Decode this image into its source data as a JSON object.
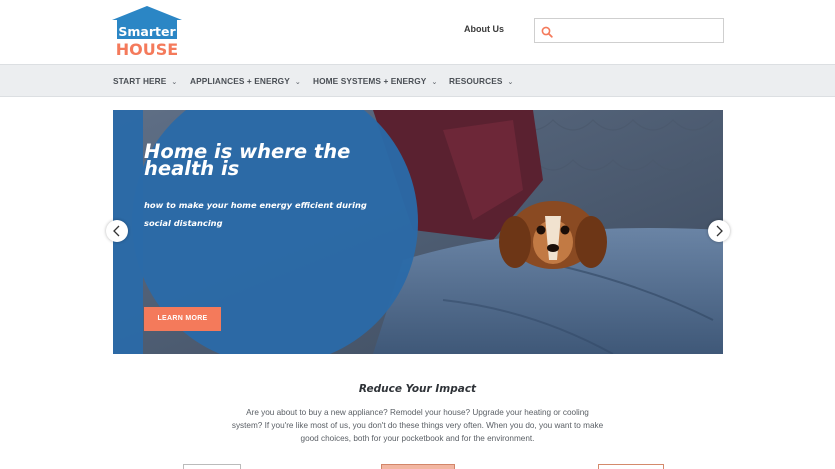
{
  "header": {
    "logo": {
      "line1": "Smarter",
      "line2": "HOUSE",
      "colors": {
        "roof": "#2b86c5",
        "text": "#f47a5b"
      }
    },
    "about_label": "About Us",
    "search": {
      "icon": "search-icon",
      "placeholder": "",
      "value": ""
    }
  },
  "nav": {
    "items": [
      {
        "label": "START HERE",
        "icon": "chevron-down-icon"
      },
      {
        "label": "APPLIANCES + ENERGY",
        "icon": "chevron-down-icon"
      },
      {
        "label": "HOME SYSTEMS + ENERGY",
        "icon": "chevron-down-icon"
      },
      {
        "label": "RESOURCES",
        "icon": "chevron-down-icon"
      }
    ]
  },
  "hero": {
    "title": "Home is where the health is",
    "subtitle": "how to make your home energy efficient during social distancing",
    "button": "LEARN MORE",
    "prev_icon": "chevron-left-icon",
    "next_icon": "chevron-right-icon",
    "colors": {
      "overlay": "#2b6aa8",
      "button": "#f47a5b"
    }
  },
  "content": {
    "title": "Reduce Your Impact",
    "text": "Are you about to buy a new appliance? Remodel your house? Upgrade your heating or cooling system? If you're like most of us, you don't do these things very often. When you do, you want to make good choices, both for your pocketbook and for the environment."
  }
}
